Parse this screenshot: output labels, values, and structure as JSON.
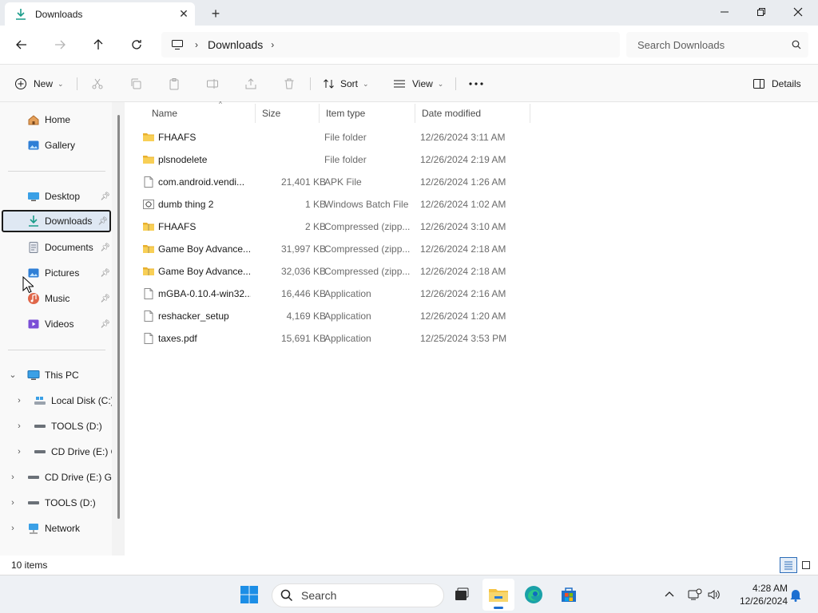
{
  "window": {
    "tab_title": "Downloads",
    "minimize_icon": "minimize-icon",
    "restore_icon": "restore-icon",
    "close_icon": "close-icon"
  },
  "address": {
    "breadcrumb": "Downloads",
    "search_placeholder": "Search Downloads"
  },
  "commands": {
    "new": "New",
    "sort": "Sort",
    "view": "View",
    "details": "Details"
  },
  "sidebar": {
    "quick": [
      {
        "label": "Home",
        "icon": "home-icon"
      },
      {
        "label": "Gallery",
        "icon": "gallery-icon"
      }
    ],
    "pinned": [
      {
        "label": "Desktop",
        "icon": "desktop-icon"
      },
      {
        "label": "Downloads",
        "icon": "download-icon"
      },
      {
        "label": "Documents",
        "icon": "documents-icon"
      },
      {
        "label": "Pictures",
        "icon": "pictures-icon"
      },
      {
        "label": "Music",
        "icon": "music-icon"
      },
      {
        "label": "Videos",
        "icon": "videos-icon"
      }
    ],
    "tree": [
      {
        "label": "This PC",
        "icon": "computer-icon"
      },
      {
        "label": "Local Disk (C:)",
        "icon": "disk-icon"
      },
      {
        "label": "TOOLS (D:)",
        "icon": "drive-icon"
      },
      {
        "label": "CD Drive (E:) G",
        "icon": "cd-drive-icon"
      },
      {
        "label": "CD Drive (E:) GP",
        "icon": "cd-drive-icon"
      },
      {
        "label": "TOOLS (D:)",
        "icon": "drive-icon"
      },
      {
        "label": "Network",
        "icon": "network-icon"
      }
    ]
  },
  "columns": {
    "name": "Name",
    "size": "Size",
    "type": "Item type",
    "date": "Date modified"
  },
  "files": [
    {
      "name": "FHAAFS",
      "size": "",
      "type": "File folder",
      "date": "12/26/2024 3:11 AM",
      "icon": "folder-icon"
    },
    {
      "name": "plsnodelete",
      "size": "",
      "type": "File folder",
      "date": "12/26/2024 2:19 AM",
      "icon": "folder-icon"
    },
    {
      "name": "com.android.vendi...",
      "size": "21,401 KB",
      "type": "APK File",
      "date": "12/26/2024 1:26 AM",
      "icon": "file-icon"
    },
    {
      "name": "dumb thing 2",
      "size": "1 KB",
      "type": "Windows Batch File",
      "date": "12/26/2024 1:02 AM",
      "icon": "batch-file-icon"
    },
    {
      "name": "FHAAFS",
      "size": "2 KB",
      "type": "Compressed (zipp...",
      "date": "12/26/2024 3:10 AM",
      "icon": "zip-folder-icon"
    },
    {
      "name": "Game Boy Advance...",
      "size": "31,997 KB",
      "type": "Compressed (zipp...",
      "date": "12/26/2024 2:18 AM",
      "icon": "zip-folder-icon"
    },
    {
      "name": "Game Boy Advance...",
      "size": "32,036 KB",
      "type": "Compressed (zipp...",
      "date": "12/26/2024 2:18 AM",
      "icon": "zip-folder-icon"
    },
    {
      "name": "mGBA-0.10.4-win32...",
      "size": "16,446 KB",
      "type": "Application",
      "date": "12/26/2024 2:16 AM",
      "icon": "file-icon"
    },
    {
      "name": "reshacker_setup",
      "size": "4,169 KB",
      "type": "Application",
      "date": "12/26/2024 1:20 AM",
      "icon": "file-icon"
    },
    {
      "name": "taxes.pdf",
      "size": "15,691 KB",
      "type": "Application",
      "date": "12/25/2024 3:53 PM",
      "icon": "file-icon"
    }
  ],
  "status": {
    "item_count": "10 items"
  },
  "taskbar": {
    "search_placeholder": "Search",
    "time": "4:28 AM",
    "date": "12/26/2024"
  },
  "colors": {
    "accent": "#1c6fd1",
    "folder": "#f5c344",
    "selected_bg": "#dfe8f3"
  }
}
